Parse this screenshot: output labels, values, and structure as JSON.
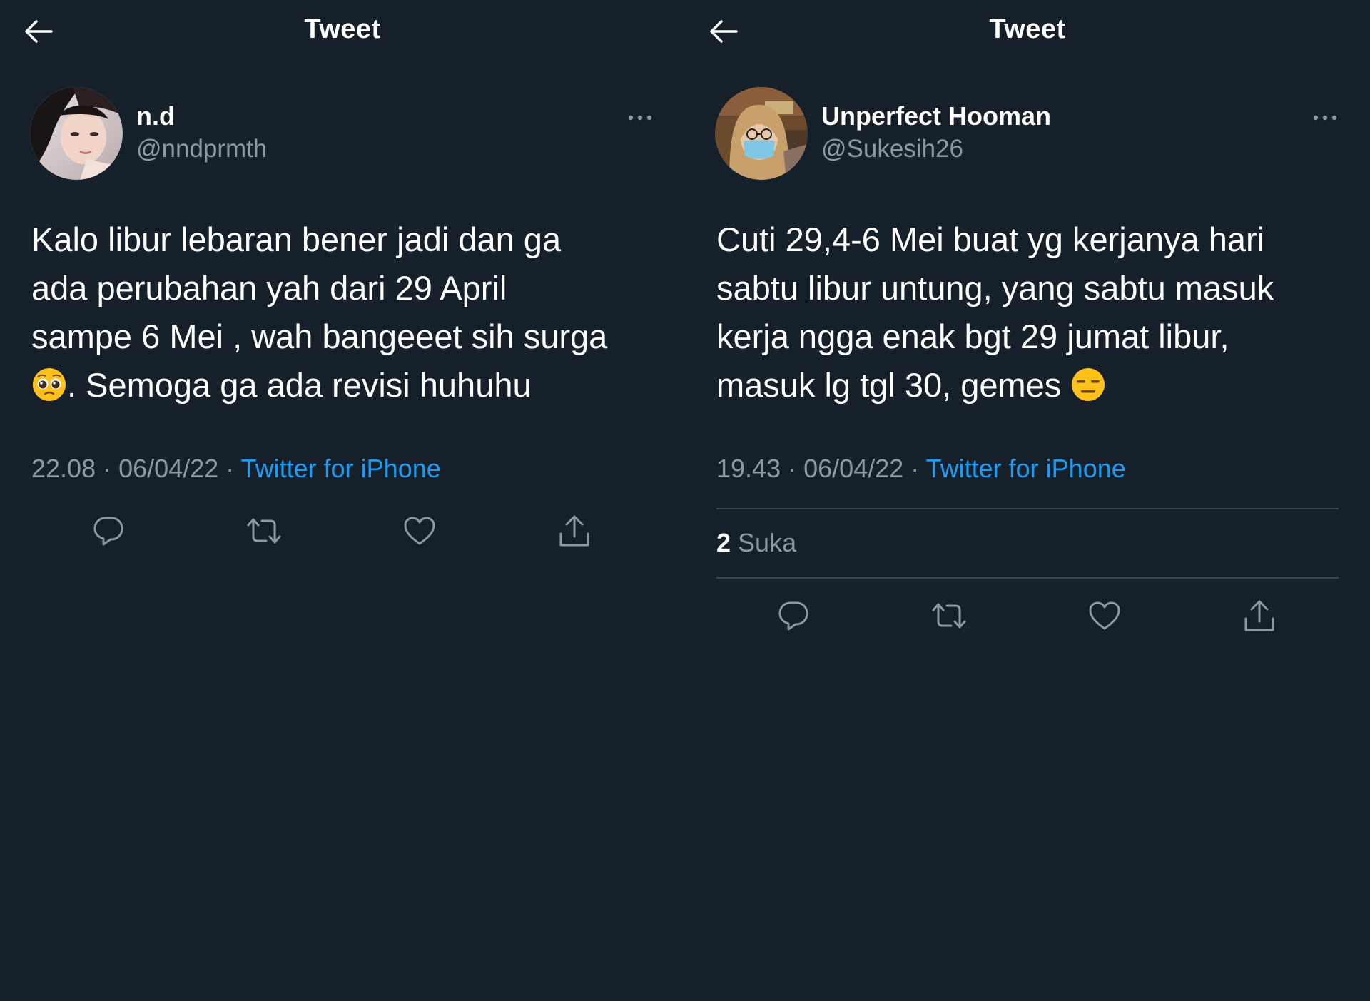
{
  "tweets": [
    {
      "header_title": "Tweet",
      "name": "n.d",
      "handle": "@nndprmth",
      "text_before_emoji": "Kalo libur lebaran bener jadi dan ga\nada perubahan yah dari 29 April\nsampe 6 Mei , wah bangeeet sih surga\n",
      "emoji": "pleading-face",
      "text_after_emoji": ". Semoga ga ada revisi huhuhu",
      "time": "22.08",
      "date": "06/04/22",
      "separator": "·",
      "source": "Twitter for iPhone"
    },
    {
      "header_title": "Tweet",
      "name": "Unperfect Hooman",
      "handle": "@Sukesih26",
      "text_before_emoji": "Cuti 29,4-6 Mei buat yg kerjanya hari\nsabtu libur untung, yang sabtu masuk\nkerja ngga enak bgt 29 jumat libur,\nmasuk lg tgl 30, gemes ",
      "emoji": "expressionless-face",
      "text_after_emoji": "",
      "time": "19.43",
      "date": "06/04/22",
      "separator": "·",
      "source": "Twitter for iPhone",
      "likes_count": "2",
      "likes_label": "Suka"
    }
  ],
  "colors": {
    "background": "#15202b",
    "text": "#ffffff",
    "secondary_text": "#8b98a5",
    "link": "#1d9bf0",
    "divider": "#38444d",
    "icon": "#8b98a5"
  },
  "icons": [
    "back-arrow-icon",
    "more-icon",
    "reply-icon",
    "retweet-icon",
    "like-icon",
    "share-icon"
  ]
}
